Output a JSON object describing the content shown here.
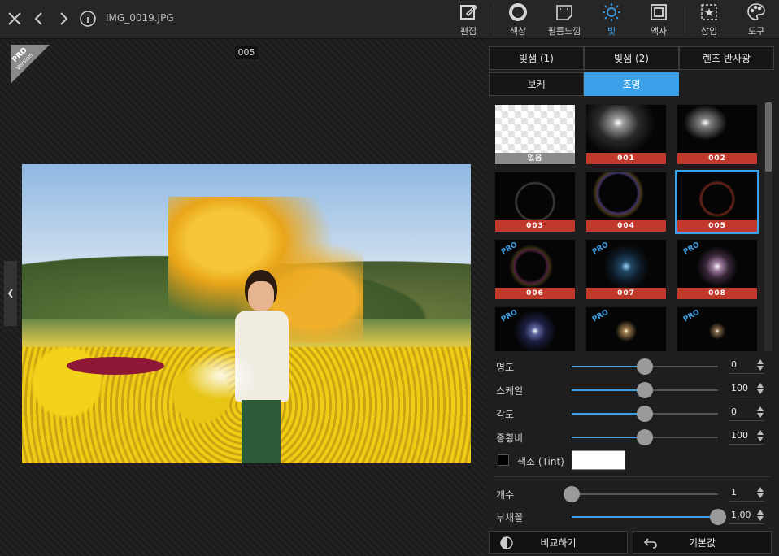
{
  "header": {
    "filename": "IMG_0019.JPG",
    "tools": [
      {
        "label": "편집",
        "icon": "edit-icon"
      },
      {
        "label": "색상",
        "icon": "color-circle-icon"
      },
      {
        "label": "필름느낌",
        "icon": "film-icon"
      },
      {
        "label": "빛",
        "icon": "light-icon",
        "active": true
      },
      {
        "label": "액자",
        "icon": "frame-icon"
      },
      {
        "label": "삽입",
        "icon": "insert-icon"
      },
      {
        "label": "도구",
        "icon": "palette-icon"
      }
    ]
  },
  "canvas": {
    "frame_label": "005",
    "pro_badge": {
      "line1": "PRO",
      "line2": "Version"
    }
  },
  "panel": {
    "tabs_row1": [
      "빛샘 (1)",
      "빛샘 (2)",
      "렌즈 반사광"
    ],
    "tabs_row2": [
      "보케",
      "조명"
    ],
    "active_tab2": "조명",
    "thumbnails": [
      {
        "caption": "없음"
      },
      {
        "caption": "001"
      },
      {
        "caption": "002"
      },
      {
        "caption": "003"
      },
      {
        "caption": "004"
      },
      {
        "caption": "005"
      },
      {
        "caption": "006",
        "pro": "PRO"
      },
      {
        "caption": "007",
        "pro": "PRO"
      },
      {
        "caption": "008",
        "pro": "PRO"
      },
      {
        "caption": "",
        "pro": "PRO"
      },
      {
        "caption": "",
        "pro": "PRO"
      },
      {
        "caption": "",
        "pro": "PRO"
      }
    ],
    "sliders": [
      {
        "label": "명도",
        "value": "0",
        "level": 0.5
      },
      {
        "label": "스케일",
        "value": "100",
        "level": 0.5
      },
      {
        "label": "각도",
        "value": "0",
        "level": 0.5
      },
      {
        "label": "종횡비",
        "value": "100",
        "level": 0.5
      }
    ],
    "tint": {
      "label": "색조 (Tint)",
      "color": "#ffffff"
    },
    "sliders2": [
      {
        "label": "개수",
        "value": "1",
        "level": 0.0
      },
      {
        "label": "부채꼴",
        "value": "1,00",
        "level": 1.0
      }
    ],
    "compare_label": "비교하기",
    "reset_label": "기본값"
  },
  "colors": {
    "accent": "#3aa0e8",
    "caption_red": "#c0392b"
  }
}
